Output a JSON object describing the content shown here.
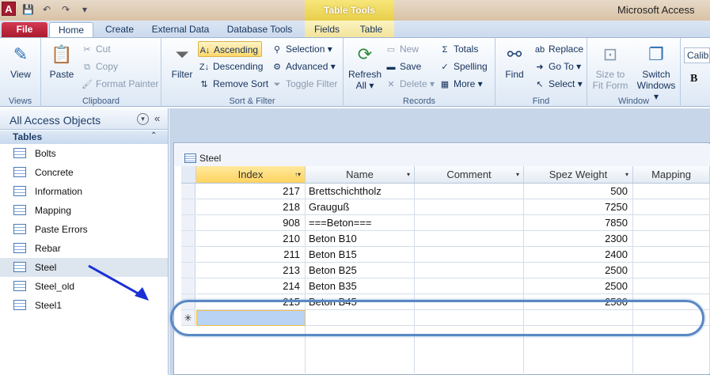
{
  "titlebar": {
    "app_icon": "A",
    "window_title": "Microsoft Access",
    "context_header": "Table Tools",
    "qat_icons": [
      "save-icon",
      "undo-icon",
      "redo-icon",
      "customize-icon"
    ]
  },
  "tabs": {
    "file": "File",
    "home": "Home",
    "create": "Create",
    "external": "External Data",
    "dbtools": "Database Tools",
    "fields": "Fields",
    "table": "Table"
  },
  "ribbon": {
    "views": {
      "view": "View",
      "group": "Views"
    },
    "clipboard": {
      "paste": "Paste",
      "cut": "Cut",
      "copy": "Copy",
      "format_painter": "Format Painter",
      "group": "Clipboard"
    },
    "sortfilter": {
      "filter": "Filter",
      "ascending": "Ascending",
      "descending": "Descending",
      "remove_sort": "Remove Sort",
      "selection": "Selection",
      "advanced": "Advanced",
      "toggle_filter": "Toggle Filter",
      "group": "Sort & Filter"
    },
    "records": {
      "refresh": "Refresh",
      "refresh2": "All",
      "new": "New",
      "save": "Save",
      "delete": "Delete",
      "totals": "Totals",
      "spelling": "Spelling",
      "more": "More",
      "group": "Records"
    },
    "find": {
      "find": "Find",
      "replace": "Replace",
      "goto": "Go To",
      "select": "Select",
      "group": "Find"
    },
    "window": {
      "size": "Size to",
      "size2": "Fit Form",
      "switch": "Switch",
      "switch2": "Windows",
      "group": "Window"
    },
    "font": {
      "name": "Calibr",
      "bold": "B"
    }
  },
  "nav": {
    "title": "All Access Objects",
    "section": "Tables",
    "items": [
      {
        "label": "Bolts"
      },
      {
        "label": "Concrete"
      },
      {
        "label": "Information"
      },
      {
        "label": "Mapping"
      },
      {
        "label": "Paste Errors"
      },
      {
        "label": "Rebar"
      },
      {
        "label": "Steel"
      },
      {
        "label": "Steel_old"
      },
      {
        "label": "Steel1"
      }
    ]
  },
  "document": {
    "tab_label": "Steel",
    "columns": [
      "Index",
      "Name",
      "Comment",
      "Spez Weight",
      "Mapping"
    ],
    "sorted_column": "Index",
    "rows": [
      {
        "index": "217",
        "name": "Brettschichtholz",
        "comment": "",
        "weight": "500"
      },
      {
        "index": "218",
        "name": "Grauguß",
        "comment": "",
        "weight": "7250"
      },
      {
        "index": "908",
        "name": "===Beton===",
        "comment": "",
        "weight": "7850"
      },
      {
        "index": "210",
        "name": "Beton B10",
        "comment": "",
        "weight": "2300"
      },
      {
        "index": "211",
        "name": "Beton B15",
        "comment": "",
        "weight": "2400"
      },
      {
        "index": "213",
        "name": "Beton B25",
        "comment": "",
        "weight": "2500"
      },
      {
        "index": "214",
        "name": "Beton B35",
        "comment": "",
        "weight": "2500"
      },
      {
        "index": "215",
        "name": "Beton B45",
        "comment": "",
        "weight": "2500"
      }
    ],
    "new_row_marker": "✳"
  },
  "colors": {
    "accent": "#5a88c4",
    "file_tab": "#c02a40",
    "context": "#f0d95c"
  }
}
